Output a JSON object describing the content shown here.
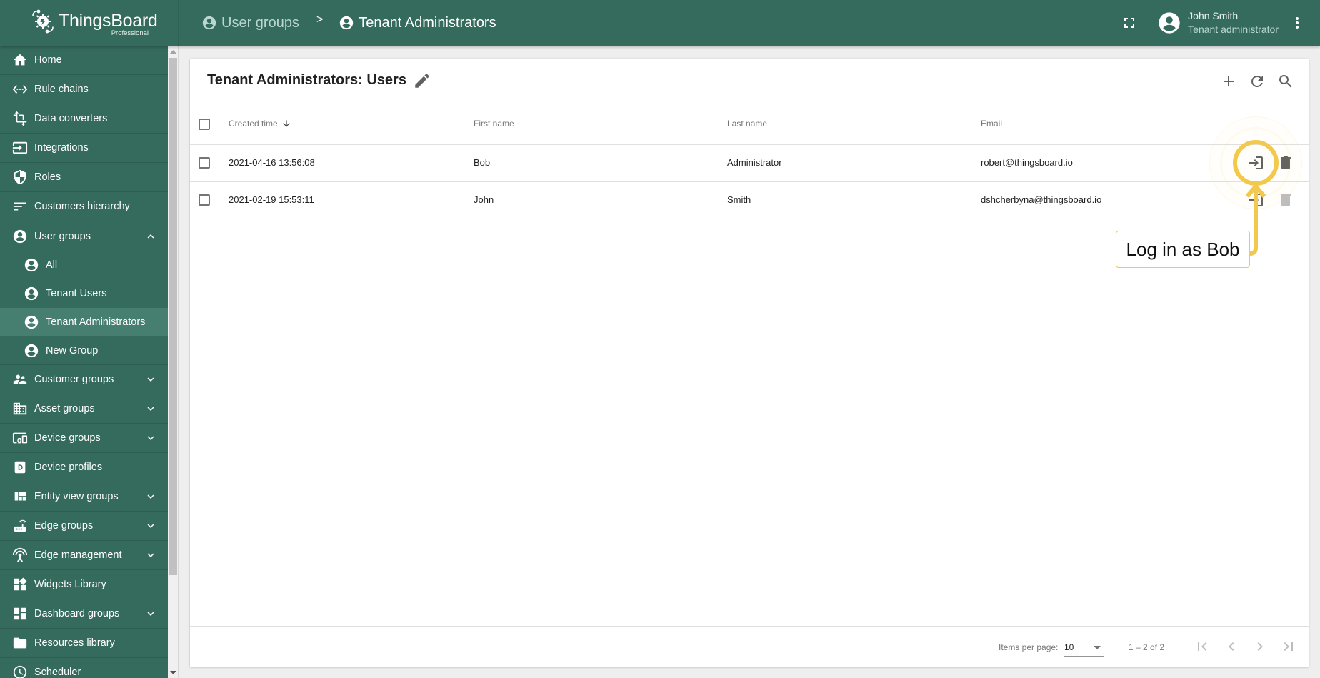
{
  "app": {
    "brand": "ThingsBoard",
    "edition": "Professional",
    "colors": {
      "primary": "#356b5c",
      "sidebar_active": "#467e70",
      "highlight": "#f2c94c"
    }
  },
  "header": {
    "breadcrumbs": [
      {
        "label": "User groups",
        "icon": "account-circle-icon"
      },
      {
        "label": "Tenant Administrators",
        "icon": "account-circle-icon"
      }
    ],
    "separator": ">",
    "user": {
      "name": "John Smith",
      "role": "Tenant administrator"
    }
  },
  "sidebar": {
    "items": [
      {
        "label": "Home",
        "icon": "home-icon"
      },
      {
        "label": "Rule chains",
        "icon": "settings-ethernet-icon"
      },
      {
        "label": "Data converters",
        "icon": "transform-icon"
      },
      {
        "label": "Integrations",
        "icon": "input-icon"
      },
      {
        "label": "Roles",
        "icon": "security-icon"
      },
      {
        "label": "Customers hierarchy",
        "icon": "sort-icon"
      },
      {
        "label": "User groups",
        "icon": "account-circle-icon",
        "expanded": true,
        "children": [
          {
            "label": "All",
            "icon": "account-circle-icon"
          },
          {
            "label": "Tenant Users",
            "icon": "account-circle-icon"
          },
          {
            "label": "Tenant Administrators",
            "icon": "account-circle-icon",
            "active": true
          },
          {
            "label": "New Group",
            "icon": "account-circle-icon"
          }
        ]
      },
      {
        "label": "Customer groups",
        "icon": "supervisor-account-icon",
        "expandable": true
      },
      {
        "label": "Asset groups",
        "icon": "domain-icon",
        "expandable": true
      },
      {
        "label": "Device groups",
        "icon": "devices-other-icon",
        "expandable": true
      },
      {
        "label": "Device profiles",
        "icon": "device-profile-icon"
      },
      {
        "label": "Entity view groups",
        "icon": "view-quilt-icon",
        "expandable": true
      },
      {
        "label": "Edge groups",
        "icon": "router-icon",
        "expandable": true
      },
      {
        "label": "Edge management",
        "icon": "settings-input-antenna-icon",
        "expandable": true
      },
      {
        "label": "Widgets Library",
        "icon": "widgets-icon"
      },
      {
        "label": "Dashboard groups",
        "icon": "dashboard-icon",
        "expandable": true
      },
      {
        "label": "Resources library",
        "icon": "folder-icon"
      },
      {
        "label": "Scheduler",
        "icon": "schedule-icon"
      }
    ]
  },
  "card": {
    "title": "Tenant Administrators: Users",
    "actions": [
      "add-icon",
      "refresh-icon",
      "search-icon"
    ],
    "columns": [
      "Created time",
      "First name",
      "Last name",
      "Email"
    ],
    "sort": {
      "column": "Created time",
      "direction": "desc"
    },
    "rows": [
      {
        "created": "2021-04-16 13:56:08",
        "first": "Bob",
        "last": "Administrator",
        "email": "robert@thingsboard.io"
      },
      {
        "created": "2021-02-19 15:53:11",
        "first": "John",
        "last": "Smith",
        "email": "dshcherbyna@thingsboard.io"
      }
    ],
    "paginator": {
      "items_per_page_label": "Items per page:",
      "items_per_page": "10",
      "range": "1 – 2 of 2"
    }
  },
  "callout": {
    "text": "Log in as Bob",
    "target": "row-0-login-as-user"
  }
}
